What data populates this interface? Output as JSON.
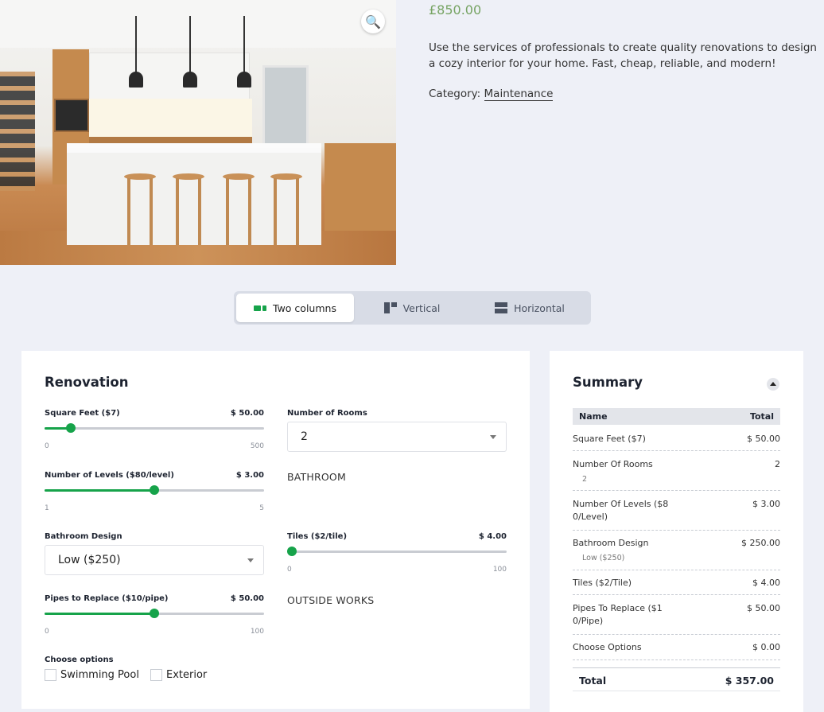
{
  "product": {
    "price": "£850.00",
    "description": "Use the services of professionals to create quality renovations to design a cozy interior for your home. Fast, cheap, reliable, and modern!",
    "category_label": "Category:",
    "category_link": "Maintenance"
  },
  "layout_switcher": {
    "options": [
      "Two columns",
      "Vertical",
      "Horizontal"
    ],
    "active": "Two columns",
    "accent_color": "#16a34a"
  },
  "calculator": {
    "title": "Renovation",
    "square_feet": {
      "label": "Square Feet ($7)",
      "value": "$ 50.00",
      "min": "0",
      "max": "500",
      "fraction": 0.12
    },
    "levels": {
      "label": "Number of Levels ($80/level)",
      "value": "$ 3.00",
      "min": "1",
      "max": "5",
      "fraction": 0.5
    },
    "bathroom_design": {
      "label": "Bathroom Design",
      "selected": "Low ($250)"
    },
    "pipes": {
      "label": "Pipes to Replace ($10/pipe)",
      "value": "$ 50.00",
      "min": "0",
      "max": "100",
      "fraction": 0.5
    },
    "choose_options": {
      "label": "Choose options",
      "options": [
        "Swimming Pool",
        "Exterior"
      ]
    },
    "rooms": {
      "label": "Number of Rooms",
      "selected": "2"
    },
    "bathroom_section": "BATHROOM",
    "tiles": {
      "label": "Tiles ($2/tile)",
      "value": "$ 4.00",
      "min": "0",
      "max": "100",
      "fraction": 0.0
    },
    "outside_section": "OUTSIDE WORKS"
  },
  "summary": {
    "title": "Summary",
    "col_name": "Name",
    "col_total": "Total",
    "rows": [
      {
        "name": "Square Feet ($7)",
        "value": "$ 50.00",
        "sub": ""
      },
      {
        "name": "Number Of Rooms",
        "value": "2",
        "sub": "2"
      },
      {
        "name": "Number Of Levels ($8 0/Level)",
        "value": "$ 3.00",
        "sub": ""
      },
      {
        "name": "Bathroom Design",
        "value": "$ 250.00",
        "sub": "Low ($250)"
      },
      {
        "name": "Tiles ($2/Tile)",
        "value": "$ 4.00",
        "sub": ""
      },
      {
        "name": "Pipes To Replace ($1 0/Pipe)",
        "value": "$ 50.00",
        "sub": ""
      },
      {
        "name": "Choose Options",
        "value": "$ 0.00",
        "sub": ""
      }
    ],
    "total_label": "Total",
    "total_value": "$ 357.00"
  }
}
